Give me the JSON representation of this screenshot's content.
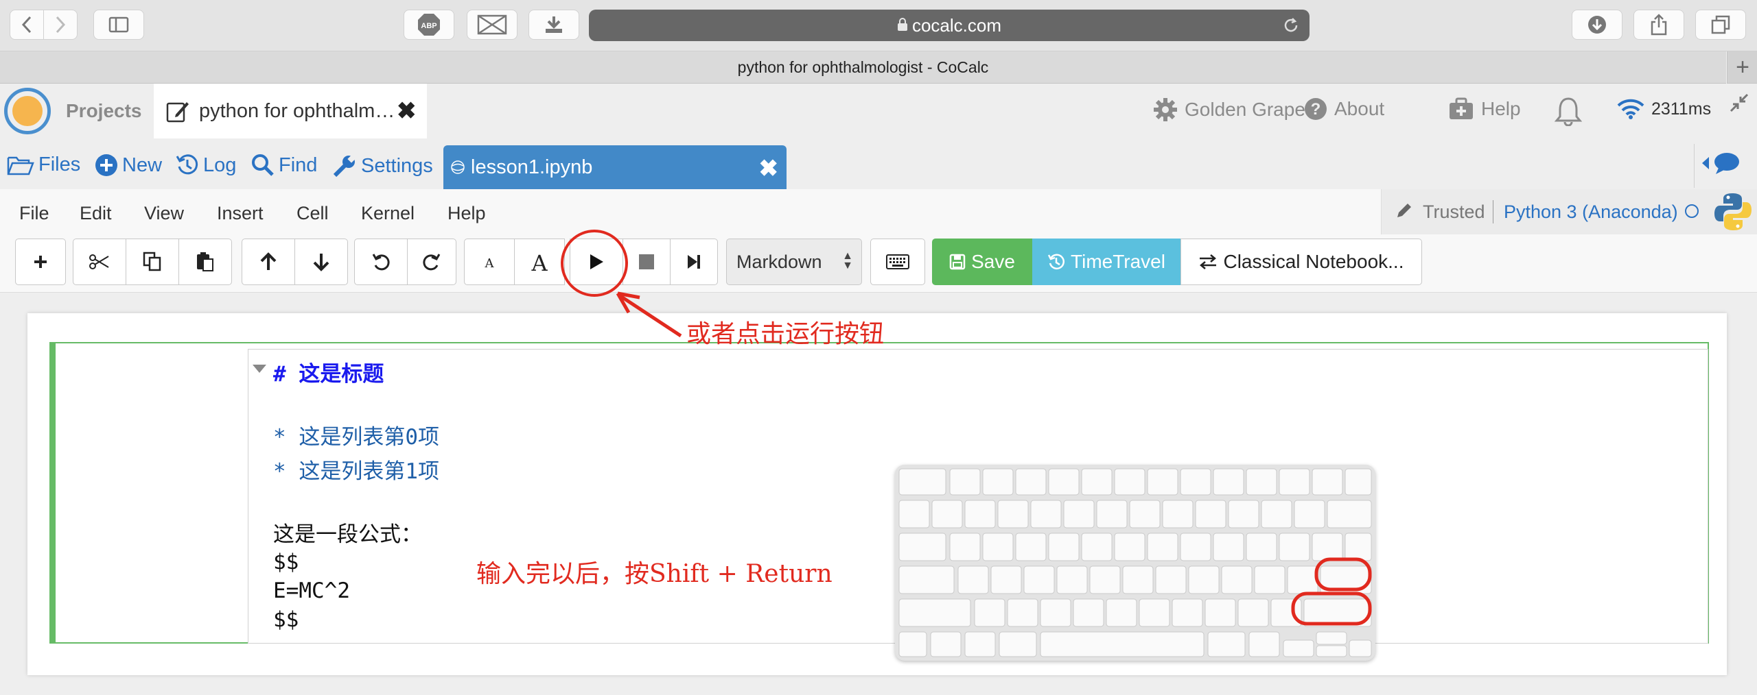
{
  "browser": {
    "url": "cocalc.com",
    "window_title": "python for ophthalmologist - CoCalc",
    "newtab_label": "+"
  },
  "topnav": {
    "projects_label": "Projects",
    "active_tab_label": "python for ophthalm…",
    "project_name": "Golden Grape",
    "about_label": "About",
    "help_label": "Help",
    "latency": "2311ms"
  },
  "filesbar": {
    "files": "Files",
    "new": "New",
    "log": "Log",
    "find": "Find",
    "settings": "Settings",
    "open_file": "lesson1.ipynb"
  },
  "menu": {
    "file": "File",
    "edit": "Edit",
    "view": "View",
    "insert": "Insert",
    "cell": "Cell",
    "kernel": "Kernel",
    "help": "Help",
    "trusted": "Trusted",
    "kernel_name": "Python 3 (Anaconda)"
  },
  "toolbar": {
    "cell_type": "Markdown",
    "save": "Save",
    "timetravel": "TimeTravel",
    "classical": "Classical Notebook..."
  },
  "cell": {
    "lines": [
      "# 这是标题",
      "* 这是列表第0项",
      "* 这是列表第1项",
      "这是一段公式：",
      "$$",
      "E=MC^2",
      "$$"
    ]
  },
  "annotations": {
    "run_button_note": "或者点击运行按钮",
    "shortcut_note": "输入完以后，按Shift + Return"
  },
  "colors": {
    "accent_blue": "#4289c8",
    "save_green": "#5cb85c",
    "timetravel_cyan": "#5bc0de",
    "cell_border_green": "#66bb66",
    "annotation_red": "#e12a1f"
  }
}
